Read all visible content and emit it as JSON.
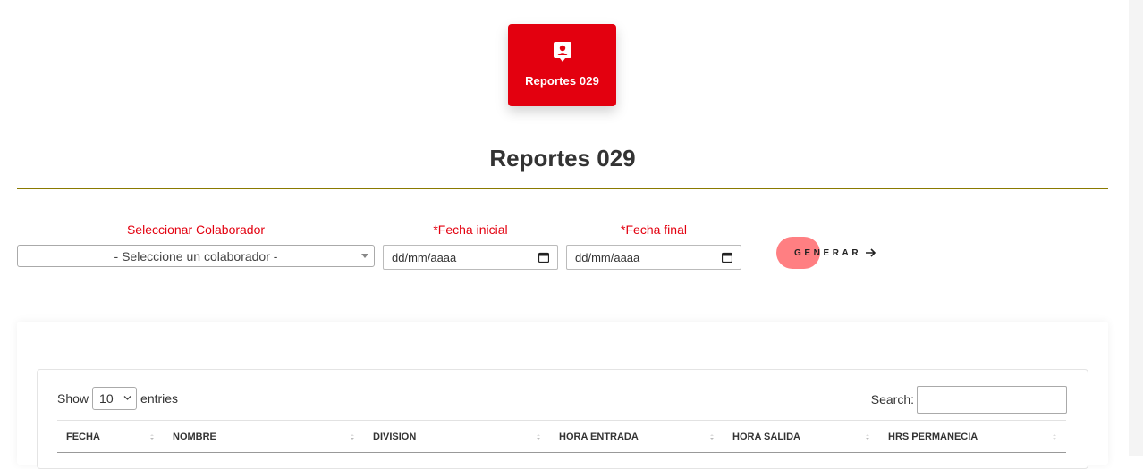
{
  "card": {
    "label": "Reportes 029",
    "icon": "user-report-icon"
  },
  "page": {
    "title": "Reportes 029"
  },
  "filters": {
    "colaborador_label": "Seleccionar Colaborador",
    "colaborador_value": "- Seleccione un colaborador -",
    "fecha_inicial_label": "*Fecha inicial",
    "fecha_inicial_value": "dd/mm/aaaa",
    "fecha_final_label": "*Fecha final",
    "fecha_final_value": "dd/mm/aaaa"
  },
  "generate": {
    "label": "GENERAR",
    "icon": "arrow-right-icon"
  },
  "table": {
    "show_label": "Show",
    "entries_value": "10",
    "entries_label": "entries",
    "search_label": "Search:",
    "columns": [
      "FECHA",
      "NOMBRE",
      "DIVISION",
      "HORA ENTRADA",
      "HORA SALIDA",
      "HRS PERMANECIA"
    ]
  },
  "colors": {
    "brand_red": "#e3000f",
    "button_blob": "#ff7f82",
    "divider": "#8a7a00"
  }
}
